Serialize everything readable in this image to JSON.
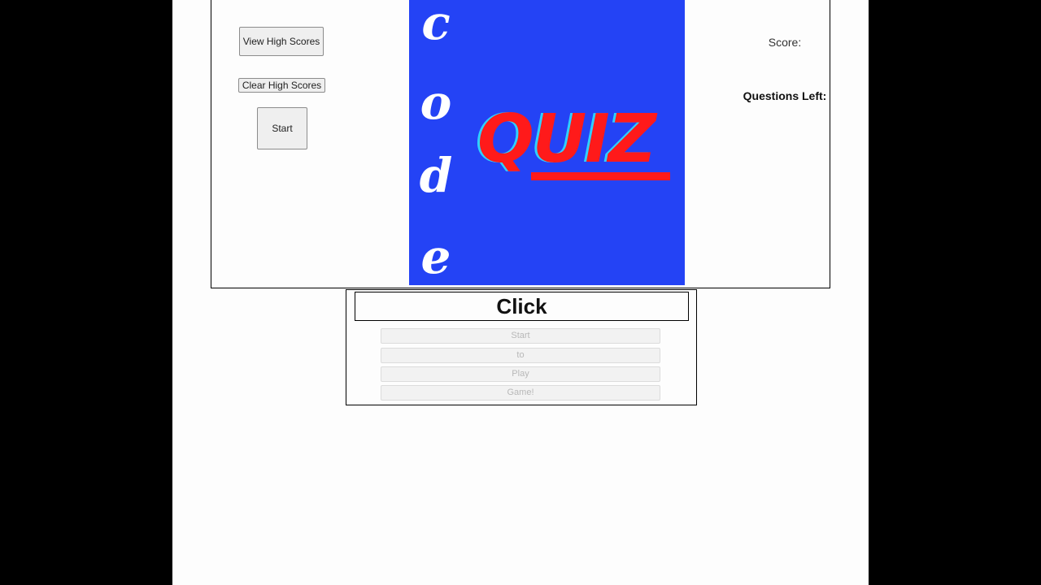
{
  "controls": {
    "view_high_scores": "View High Scores",
    "clear_high_scores": "Clear High Scores",
    "start": "Start"
  },
  "logo": {
    "letters": [
      "c",
      "o",
      "d",
      "e"
    ],
    "word": "QUIZ",
    "colors": {
      "background": "#2443f5",
      "letters": "#ffffff",
      "word": "#ff1a1a",
      "word_shadow": "#2fd1ff"
    }
  },
  "stats": {
    "score_label": "Score:",
    "questions_left_label": "Questions Left:"
  },
  "question": {
    "text": "Click",
    "answers": [
      "Start",
      "to",
      "Play",
      "Game!"
    ]
  }
}
